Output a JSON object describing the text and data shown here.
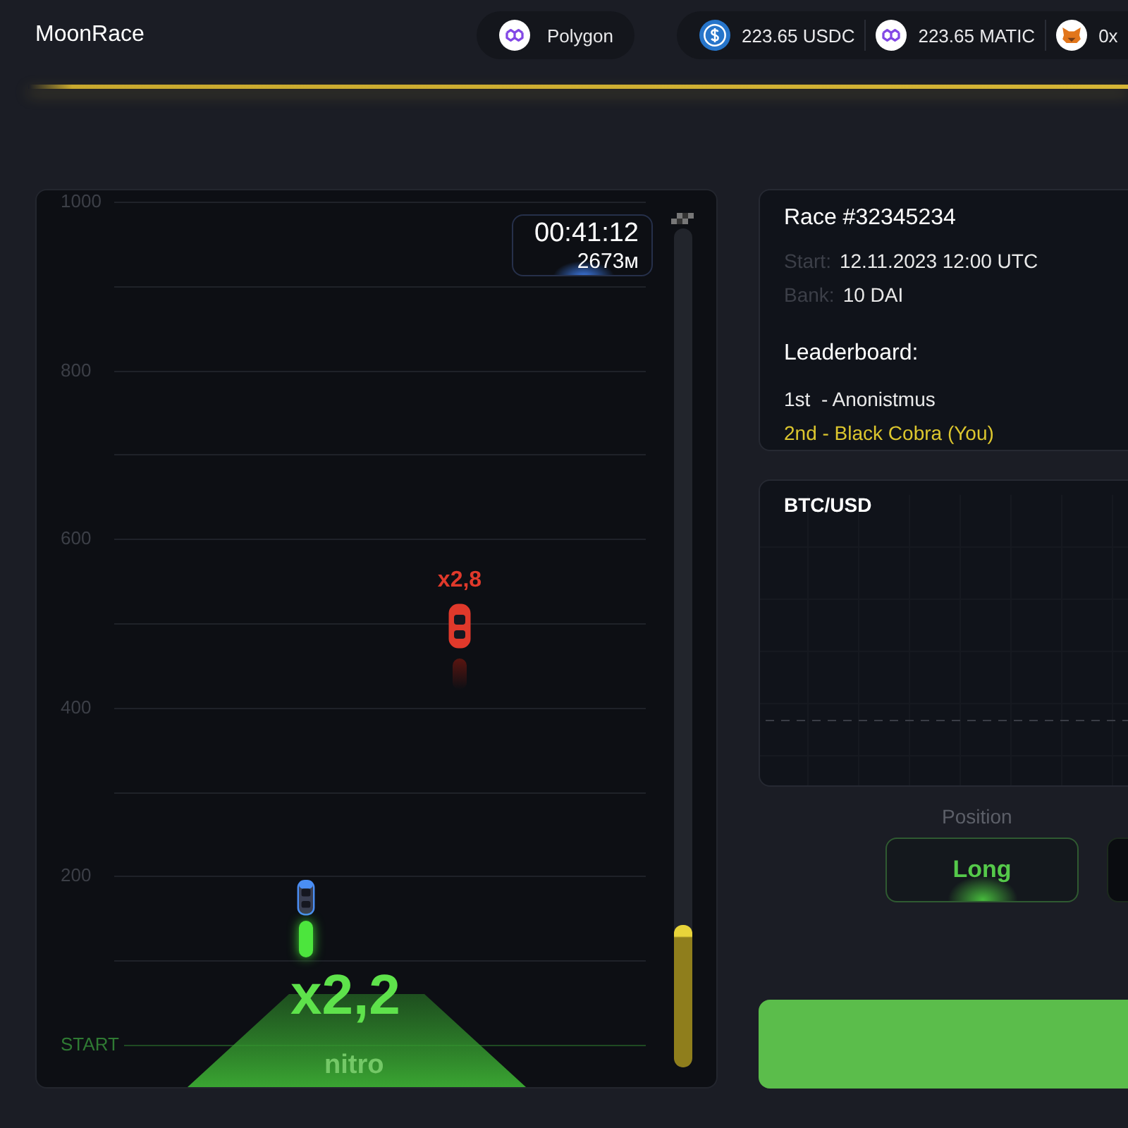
{
  "header": {
    "brand": "MoonRace",
    "network": {
      "name": "Polygon",
      "kind": "matic"
    },
    "balances": [
      {
        "amount": "223.65 USDC",
        "kind": "usdc"
      },
      {
        "amount": "223.65 MATIC",
        "kind": "matic"
      },
      {
        "amount": "0x",
        "kind": "wallet"
      }
    ]
  },
  "track": {
    "axis_labels": [
      "1000",
      "800",
      "600",
      "400",
      "200",
      "START"
    ],
    "timer": "00:41:12",
    "distance": "2673м",
    "progress": {
      "level": 0.17
    },
    "cars": [
      {
        "kind": "rival",
        "multiplier": "x2,8",
        "color": "#e0392b"
      },
      {
        "kind": "player",
        "color": "#4a8ef5"
      }
    ],
    "nitro": {
      "multiplier": "x2,2",
      "label": "nitro"
    }
  },
  "race": {
    "title": "Race #32345234",
    "details": [
      {
        "label": "Start:",
        "value": "12.11.2023 12:00 UTC"
      },
      {
        "label": "Bank:",
        "value": "10 DAI"
      }
    ],
    "leaderboard_title": "Leaderboard:",
    "leaderboard": [
      {
        "text": "1st  - Anonistmus",
        "is_you": false
      },
      {
        "text": "2nd - Black Cobra (You)",
        "is_you": true
      }
    ]
  },
  "chart": {
    "title": "BTC/USD"
  },
  "position": {
    "label": "Position",
    "options": [
      {
        "label": "Long",
        "selected": true
      },
      {
        "selected": false
      }
    ]
  }
}
